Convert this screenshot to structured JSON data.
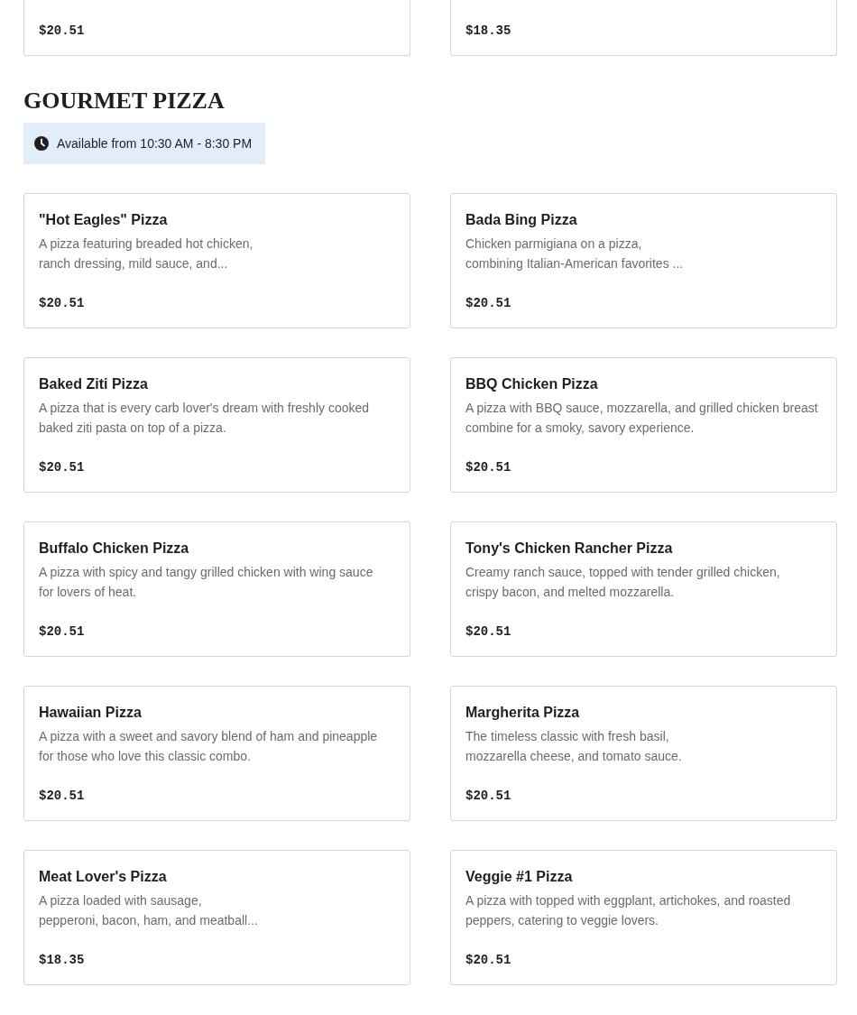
{
  "previous_items": [
    {
      "price": "$20.51"
    },
    {
      "price": "$18.35"
    }
  ],
  "section": {
    "title": "GOURMET PIZZA",
    "availability": "Available from 10:30 AM - 8:30 PM"
  },
  "items": [
    {
      "name": "\"Hot Eagles\" Pizza",
      "description": "A pizza featuring breaded hot chicken,\nranch dressing, mild sauce, and...",
      "price": "$20.51"
    },
    {
      "name": "Bada Bing Pizza",
      "description": "Chicken parmigiana on a pizza,\ncombining Italian-American favorites ...",
      "price": "$20.51"
    },
    {
      "name": "Baked Ziti Pizza",
      "description": "A pizza that is every carb lover's dream with freshly cooked\nbaked ziti pasta on top of a pizza.",
      "price": "$20.51"
    },
    {
      "name": "BBQ Chicken Pizza",
      "description": "A pizza with BBQ sauce, mozzarella, and grilled chicken breast\ncombine for a smoky, savory experience.",
      "price": "$20.51"
    },
    {
      "name": "Buffalo Chicken Pizza",
      "description": "A pizza with spicy and tangy grilled chicken with wing sauce\nfor lovers of heat.",
      "price": "$20.51"
    },
    {
      "name": "Tony's Chicken Rancher Pizza",
      "description": "Creamy ranch sauce, topped with tender grilled chicken,\ncrispy bacon, and melted mozzarella.",
      "price": "$20.51"
    },
    {
      "name": "Hawaiian Pizza",
      "description": "A pizza with a sweet and savory blend of ham and pineapple\nfor those who love this classic combo.",
      "price": "$20.51"
    },
    {
      "name": "Margherita Pizza",
      "description": "The timeless classic with fresh basil,\nmozzarella cheese, and tomato sauce.",
      "price": "$20.51"
    },
    {
      "name": "Meat Lover's Pizza",
      "description": "A pizza loaded with sausage,\npepperoni, bacon, ham, and meatball...",
      "price": "$18.35"
    },
    {
      "name": "Veggie #1 Pizza",
      "description": "A pizza with topped with eggplant, artichokes, and roasted\npeppers, catering to veggie lovers.",
      "price": "$20.51"
    }
  ]
}
